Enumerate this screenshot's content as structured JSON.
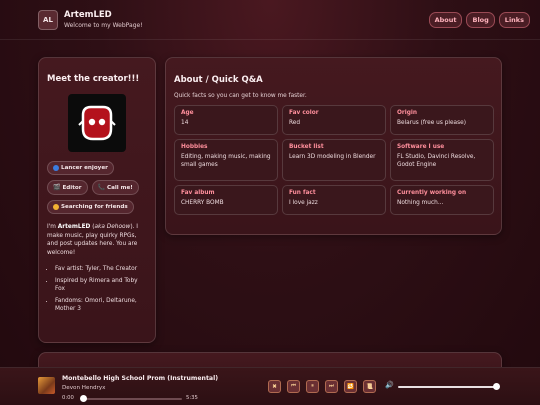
{
  "header": {
    "logo_initials": "AL",
    "site_name": "ArtemLED",
    "tagline": "Welcome to my WebPage!",
    "nav": [
      "About",
      "Blog",
      "Links"
    ]
  },
  "creator": {
    "title": "Meet the creator!!!",
    "pills": [
      "Lancer enjoyer",
      "Editor",
      "Call me!",
      "Searching for friends"
    ],
    "pill_icons": [
      "blue-dot-icon",
      "clapperboard-icon",
      "phone-icon",
      "smile-icon"
    ],
    "bio_name": "ArtemLED",
    "bio_aka": "aka Dehoow",
    "bio_rest": "I make music, play quirky RPGs, and post updates here. You are welcome!",
    "facts": [
      "Fav artist: Tyler, The Creator",
      "Inspired by Rimera and Toby Fox",
      "Fandoms: Omori, Deltarune, Mother 3"
    ]
  },
  "qa": {
    "title": "About / Quick Q&A",
    "subtitle": "Quick facts so you can get to know me faster.",
    "items": [
      {
        "key": "Age",
        "value": "14"
      },
      {
        "key": "Fav color",
        "value": "Red"
      },
      {
        "key": "Origin",
        "value": "Belarus (free us please)"
      },
      {
        "key": "Hobbies",
        "value": "Editing, making music, making small games"
      },
      {
        "key": "Bucket list",
        "value": "Learn 3D modeling in Blender"
      },
      {
        "key": "Software I use",
        "value": "FL Studio, Davinci Resolve, Godot Engine"
      },
      {
        "key": "Fav album",
        "value": "CHERRY BOMB"
      },
      {
        "key": "Fun fact",
        "value": "I love jazz"
      },
      {
        "key": "Currently working on",
        "value": "Nothing much..."
      }
    ]
  },
  "player": {
    "track_title": "Montebello High School Prom (Instrumental)",
    "artist": "Devon Hendryx",
    "time_current": "0:00",
    "time_total": "5:35",
    "progress": 0.0,
    "volume": 0.97,
    "controls": [
      "shuffle-icon",
      "previous-icon",
      "pause-icon",
      "next-icon",
      "repeat-icon",
      "playlist-icon"
    ]
  },
  "colors": {
    "accent": "#ff8f9c",
    "background": "#2e0f15",
    "card": "#3e161c"
  }
}
